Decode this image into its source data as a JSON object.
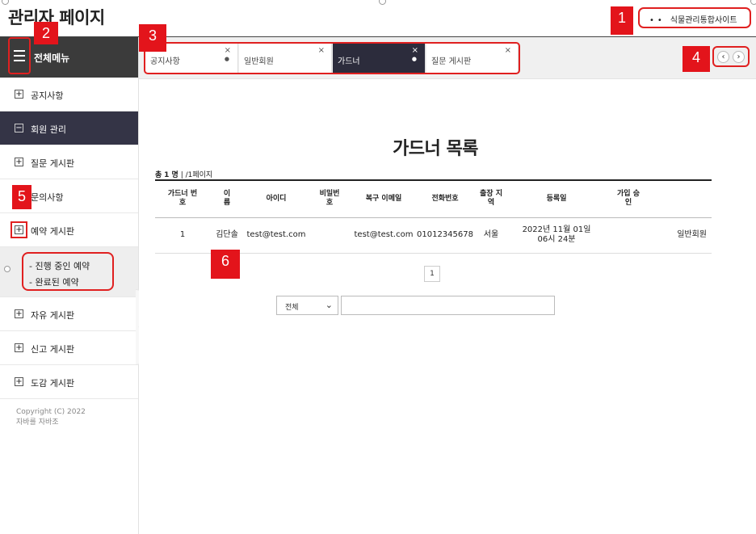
{
  "header": {
    "title": "관리자 페이지",
    "site_link": "식물관리통합사이트"
  },
  "sidebar": {
    "menu_title": "전체메뉴",
    "items": [
      {
        "label": "공지사항",
        "toggle": "+"
      },
      {
        "label": "회원 관리",
        "toggle": "−"
      },
      {
        "label": "질문 게시판",
        "toggle": "+"
      },
      {
        "label": "문의사항",
        "toggle": "+"
      },
      {
        "label": "예약 게시판",
        "toggle": "+"
      },
      {
        "label": "자유 게시판",
        "toggle": "+"
      },
      {
        "label": "신고 게시판",
        "toggle": "+"
      },
      {
        "label": "도감 게시판",
        "toggle": "+"
      }
    ],
    "sub_items": [
      "- 진행 중인 예약",
      "- 완료된 예약"
    ],
    "copyright_line1": "Copyright (C) 2022",
    "copyright_line2": "자바를 자바조"
  },
  "tabs": [
    {
      "label": "공지사항",
      "active": false
    },
    {
      "label": "일반회원",
      "active": false
    },
    {
      "label": "가드너",
      "active": true
    },
    {
      "label": "질문 게시판",
      "active": false
    }
  ],
  "tab_nav": {
    "prev": "‹",
    "next": "›"
  },
  "main": {
    "title": "가드너 목록",
    "count_prefix": "총",
    "count_value": "1 명",
    "count_suffix": " | /1페이지",
    "columns": [
      "가드너 번호",
      "이름",
      "아이디",
      "비밀번호",
      "복구 이메일",
      "전화번호",
      "출장 지역",
      "등록일",
      "가입 승인"
    ],
    "rows": [
      [
        "1",
        "김단솔",
        "test@test.com",
        "",
        "test@test.com",
        "01012345678",
        "서울",
        "2022년 11월 01일 06시 24분",
        "",
        "일반회원"
      ]
    ],
    "page": "1",
    "search_select": "전체",
    "search_value": ""
  },
  "markers": [
    "1",
    "2",
    "3",
    "4",
    "5",
    "6"
  ],
  "colors": {
    "marker": "#e3141b",
    "sidebar_dark": "#343446",
    "active_tab": "#2c2c3c"
  }
}
